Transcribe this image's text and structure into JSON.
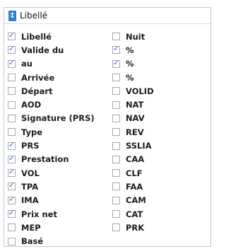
{
  "header": {
    "sort_icon": "↕",
    "label": "Libellé"
  },
  "left_items": [
    {
      "label": "Libellé",
      "checked": true
    },
    {
      "label": "Valide du",
      "checked": true
    },
    {
      "label": "au",
      "checked": true
    },
    {
      "label": "Arrivée",
      "checked": false
    },
    {
      "label": "Départ",
      "checked": false
    },
    {
      "label": "AOD",
      "checked": false
    },
    {
      "label": "Signature (PRS)",
      "checked": false
    },
    {
      "label": "Type",
      "checked": false
    },
    {
      "label": "PRS",
      "checked": true
    },
    {
      "label": "Prestation",
      "checked": true
    },
    {
      "label": "VOL",
      "checked": true
    },
    {
      "label": "TPA",
      "checked": true
    },
    {
      "label": "IMA",
      "checked": true
    },
    {
      "label": "Prix net",
      "checked": true
    },
    {
      "label": "MEP",
      "checked": false
    },
    {
      "label": "Basé",
      "checked": false
    }
  ],
  "right_items": [
    {
      "label": "Nuit",
      "checked": false
    },
    {
      "label": "%",
      "checked": true
    },
    {
      "label": "%",
      "checked": true
    },
    {
      "label": "%",
      "checked": false
    },
    {
      "label": "VOLID",
      "checked": false
    },
    {
      "label": "NAT",
      "checked": false
    },
    {
      "label": "NAV",
      "checked": false
    },
    {
      "label": "REV",
      "checked": false
    },
    {
      "label": "SSLIA",
      "checked": false
    },
    {
      "label": "CAA",
      "checked": false
    },
    {
      "label": "CLF",
      "checked": false
    },
    {
      "label": "FAA",
      "checked": false
    },
    {
      "label": "CAM",
      "checked": false
    },
    {
      "label": "CAT",
      "checked": false
    },
    {
      "label": "PRK",
      "checked": false
    }
  ]
}
